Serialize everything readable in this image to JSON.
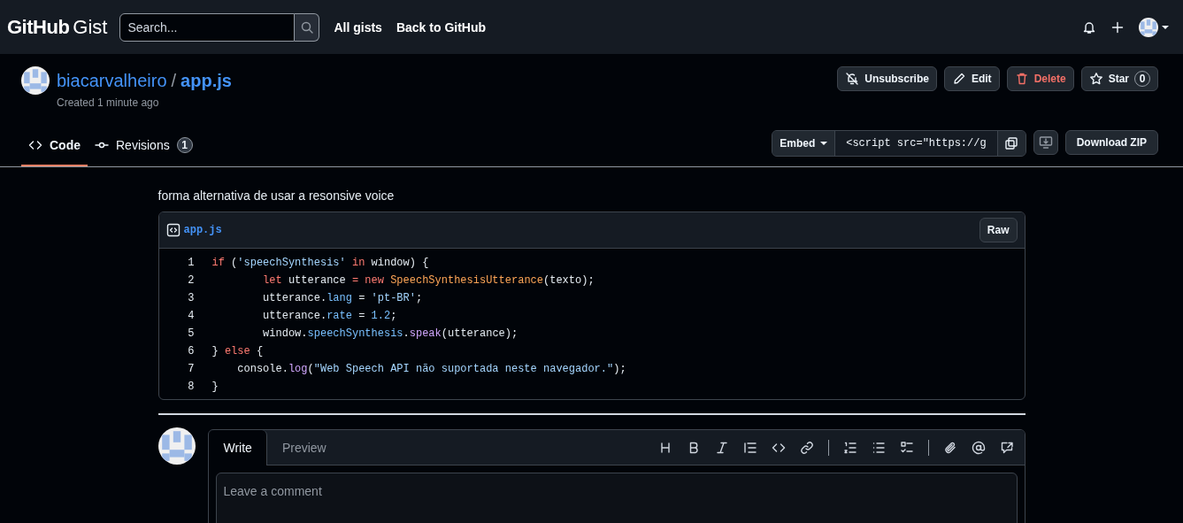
{
  "header": {
    "logo_bold": "GitHub",
    "logo_light": "Gist",
    "search": {
      "placeholder": "Search..."
    },
    "nav_links": [
      "All gists",
      "Back to GitHub"
    ]
  },
  "gist": {
    "owner": "biacarvalheiro",
    "separator": "/",
    "filename": "app.js",
    "created": "Created 1 minute ago",
    "actions": [
      {
        "label": "Unsubscribe",
        "kind": "unsubscribe"
      },
      {
        "label": "Edit",
        "kind": "edit"
      },
      {
        "label": "Delete",
        "kind": "delete"
      },
      {
        "label": "Star",
        "kind": "star",
        "count": "0"
      }
    ]
  },
  "tabs": [
    {
      "label": "Code",
      "kind": "code",
      "selected": true
    },
    {
      "label": "Revisions",
      "kind": "revisions",
      "count": "1",
      "selected": false
    }
  ],
  "embed": {
    "label": "Embed",
    "value": "<script src=\"https://g"
  },
  "download": "Download ZIP",
  "description": "forma alternativa de usar a resonsive voice",
  "file": {
    "name": "app.js",
    "raw": "Raw",
    "lines": [
      {
        "number": "1",
        "tokens": [
          {
            "text": "if",
            "kind": "keyword"
          },
          {
            "text": " (",
            "kind": "plain"
          },
          {
            "text": "'speechSynthesis'",
            "kind": "string"
          },
          {
            "text": " in",
            "kind": "keyword"
          },
          {
            "text": " window) {",
            "kind": "plain"
          }
        ]
      },
      {
        "number": "2",
        "tokens": [
          {
            "text": "        let",
            "kind": "keyword"
          },
          {
            "text": " utterance ",
            "kind": "plain"
          },
          {
            "text": "=",
            "kind": "keyword"
          },
          {
            "text": " new",
            "kind": "keyword"
          },
          {
            "text": " SpeechSynthesisUtterance",
            "kind": "class"
          },
          {
            "text": "(texto);",
            "kind": "plain"
          }
        ]
      },
      {
        "number": "3",
        "tokens": [
          {
            "text": "        utterance.",
            "kind": "plain"
          },
          {
            "text": "lang",
            "kind": "property"
          },
          {
            "text": " = ",
            "kind": "plain"
          },
          {
            "text": "'pt-BR'",
            "kind": "string"
          },
          {
            "text": ";",
            "kind": "plain"
          }
        ]
      },
      {
        "number": "4",
        "tokens": [
          {
            "text": "        utterance.",
            "kind": "plain"
          },
          {
            "text": "rate",
            "kind": "property"
          },
          {
            "text": " = ",
            "kind": "plain"
          },
          {
            "text": "1.2",
            "kind": "property"
          },
          {
            "text": ";",
            "kind": "plain"
          }
        ]
      },
      {
        "number": "5",
        "tokens": [
          {
            "text": "        window.",
            "kind": "plain"
          },
          {
            "text": "speechSynthesis",
            "kind": "property"
          },
          {
            "text": ".",
            "kind": "plain"
          },
          {
            "text": "speak",
            "kind": "function"
          },
          {
            "text": "(utterance);",
            "kind": "plain"
          }
        ]
      },
      {
        "number": "6",
        "tokens": [
          {
            "text": "} ",
            "kind": "plain"
          },
          {
            "text": "else",
            "kind": "keyword"
          },
          {
            "text": " {",
            "kind": "plain"
          }
        ]
      },
      {
        "number": "7",
        "tokens": [
          {
            "text": "    console.",
            "kind": "plain"
          },
          {
            "text": "log",
            "kind": "function"
          },
          {
            "text": "(",
            "kind": "plain"
          },
          {
            "text": "\"Web Speech API não suportada neste navegador.\"",
            "kind": "string"
          },
          {
            "text": ");",
            "kind": "plain"
          }
        ]
      },
      {
        "number": "8",
        "tokens": [
          {
            "text": "}",
            "kind": "plain"
          }
        ]
      }
    ]
  },
  "comment": {
    "tabs": [
      {
        "label": "Write",
        "selected": true
      },
      {
        "label": "Preview",
        "selected": false
      }
    ],
    "placeholder": "Leave a comment"
  }
}
